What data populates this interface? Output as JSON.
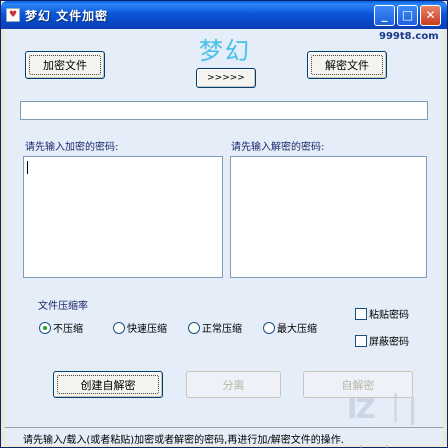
{
  "window": {
    "title": "梦幻 文件加密",
    "icon": "app-icon"
  },
  "titlebar_buttons": {
    "minimize": "_",
    "maximize": "□",
    "close": "✕"
  },
  "brand": {
    "url": "999t8.com",
    "logo": "梦幻"
  },
  "toolbar": {
    "encrypt_label": "加密文件",
    "arrow_label": ">>>>>",
    "decrypt_label": "解密文件"
  },
  "path_input": {
    "value": ""
  },
  "encrypt_panel": {
    "label": "请先输入加密的密码:",
    "value": ""
  },
  "decrypt_panel": {
    "label": "请先输入解密的密码:",
    "value": ""
  },
  "compression": {
    "label": "文件压缩率",
    "options": [
      "不压缩",
      "快速压缩",
      "正常压缩",
      "最大压缩"
    ],
    "selected": "不压缩"
  },
  "checkboxes": {
    "paste_password": "粘贴密码",
    "hide_password": "屏蔽密码"
  },
  "actions": {
    "create_sfx_label": "创建自解密",
    "split_label": "分离",
    "self_decrypt_label": "自解密"
  },
  "status": {
    "text": "请先输入/载入(或者粘贴)加密或者解密的密码,再进行加/解密文件的操作."
  },
  "watermark": {
    "text": "IZ ｜| ｜｜"
  }
}
